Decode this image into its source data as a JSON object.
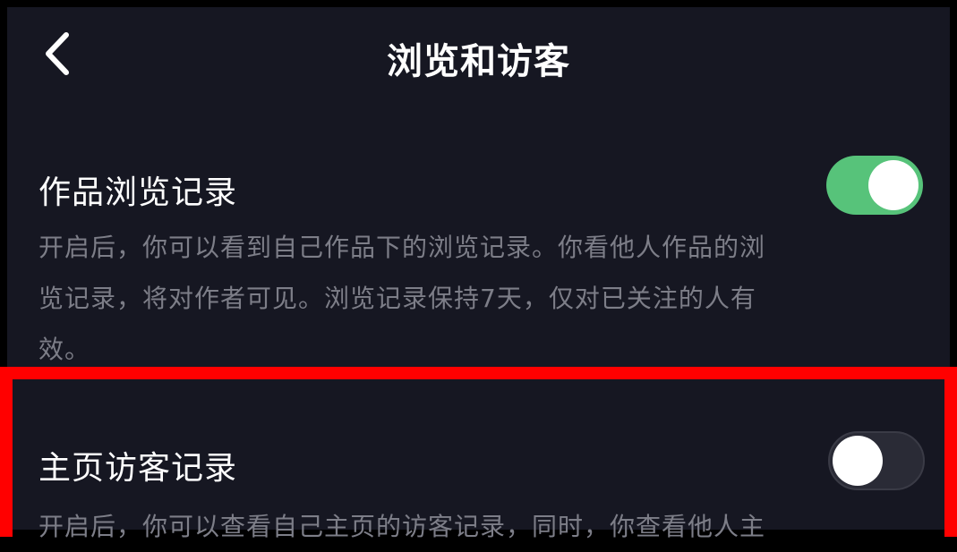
{
  "header": {
    "title": "浏览和访客"
  },
  "settings": [
    {
      "label": "作品浏览记录",
      "enabled": true,
      "description_lines": [
        "开启后，你可以看到自己作品下的浏览记录。你看他人作品的浏",
        "览记录，将对作者可见。浏览记录保持7天，仅对已关注的人有",
        "效。"
      ]
    },
    {
      "label": "主页访客记录",
      "enabled": false,
      "description_lines": [
        "开启后，你可以查看自己主页的访客记录，同时，你查看他人主"
      ]
    }
  ],
  "colors": {
    "background": "#161722",
    "toggle_on": "#57c37a",
    "highlight": "#ff0000"
  }
}
